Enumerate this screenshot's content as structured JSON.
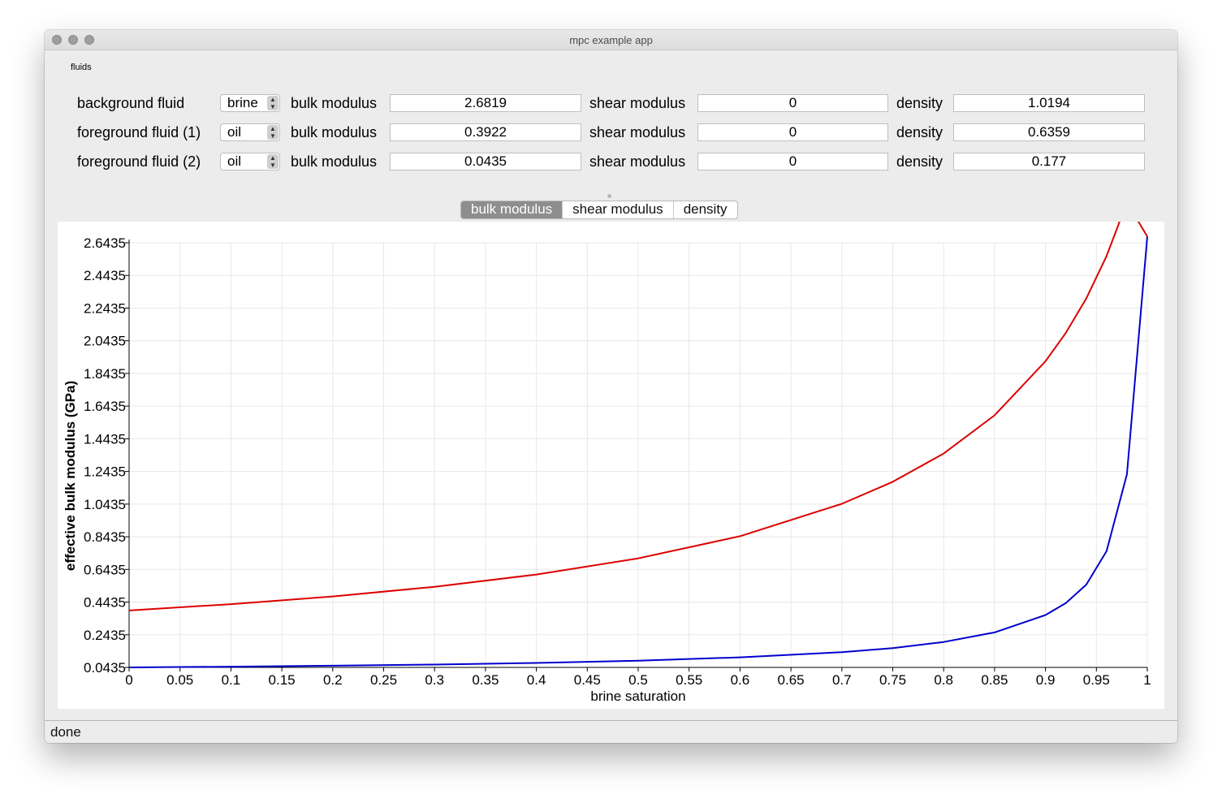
{
  "window": {
    "title": "mpc example app"
  },
  "fluids": {
    "group_title": "fluids",
    "rows": [
      {
        "label": "background fluid",
        "fluid": "brine",
        "bulk_label": "bulk modulus",
        "bulk": "2.6819",
        "shear_label": "shear modulus",
        "shear": "0",
        "density_label": "density",
        "density": "1.0194"
      },
      {
        "label": "foreground fluid (1)",
        "fluid": "oil",
        "bulk_label": "bulk modulus",
        "bulk": "0.3922",
        "shear_label": "shear modulus",
        "shear": "0",
        "density_label": "density",
        "density": "0.6359"
      },
      {
        "label": "foreground fluid (2)",
        "fluid": "oil",
        "bulk_label": "bulk modulus",
        "bulk": "0.0435",
        "shear_label": "shear modulus",
        "shear": "0",
        "density_label": "density",
        "density": "0.177"
      }
    ]
  },
  "tabs": [
    {
      "label": "bulk modulus",
      "active": true
    },
    {
      "label": "shear modulus",
      "active": false
    },
    {
      "label": "density",
      "active": false
    }
  ],
  "status": {
    "text": "done"
  },
  "chart_data": {
    "type": "line",
    "title": "",
    "xlabel": "brine saturation",
    "ylabel": "effective bulk modulus (GPa)",
    "xlim": [
      0,
      1
    ],
    "ylim": [
      0.0435,
      2.6435
    ],
    "xticks": [
      "0",
      "0.05",
      "0.1",
      "0.15",
      "0.2",
      "0.25",
      "0.3",
      "0.35",
      "0.4",
      "0.45",
      "0.5",
      "0.55",
      "0.6",
      "0.65",
      "0.7",
      "0.75",
      "0.8",
      "0.85",
      "0.9",
      "0.95",
      "1"
    ],
    "yticks": [
      "0.0435",
      "0.2435",
      "0.4435",
      "0.6435",
      "0.8435",
      "1.0435",
      "1.2435",
      "1.4435",
      "1.6435",
      "1.8435",
      "2.0435",
      "2.2435",
      "2.4435",
      "2.6435"
    ],
    "grid": true,
    "x": [
      0,
      0.1,
      0.2,
      0.3,
      0.4,
      0.5,
      0.6,
      0.7,
      0.75,
      0.8,
      0.85,
      0.9,
      0.92,
      0.94,
      0.96,
      0.98,
      1.0
    ],
    "series": [
      {
        "color": "#dd0000",
        "values": [
          0.392,
          0.431,
          0.478,
          0.537,
          0.612,
          0.711,
          0.847,
          1.045,
          1.18,
          1.353,
          1.587,
          1.918,
          2.092,
          2.302,
          2.562,
          2.891,
          2.682
        ]
      },
      {
        "color": "#0000cc",
        "values": [
          0.0435,
          0.048,
          0.054,
          0.061,
          0.071,
          0.085,
          0.105,
          0.137,
          0.162,
          0.199,
          0.258,
          0.364,
          0.437,
          0.55,
          0.755,
          1.225,
          2.682
        ]
      }
    ]
  }
}
